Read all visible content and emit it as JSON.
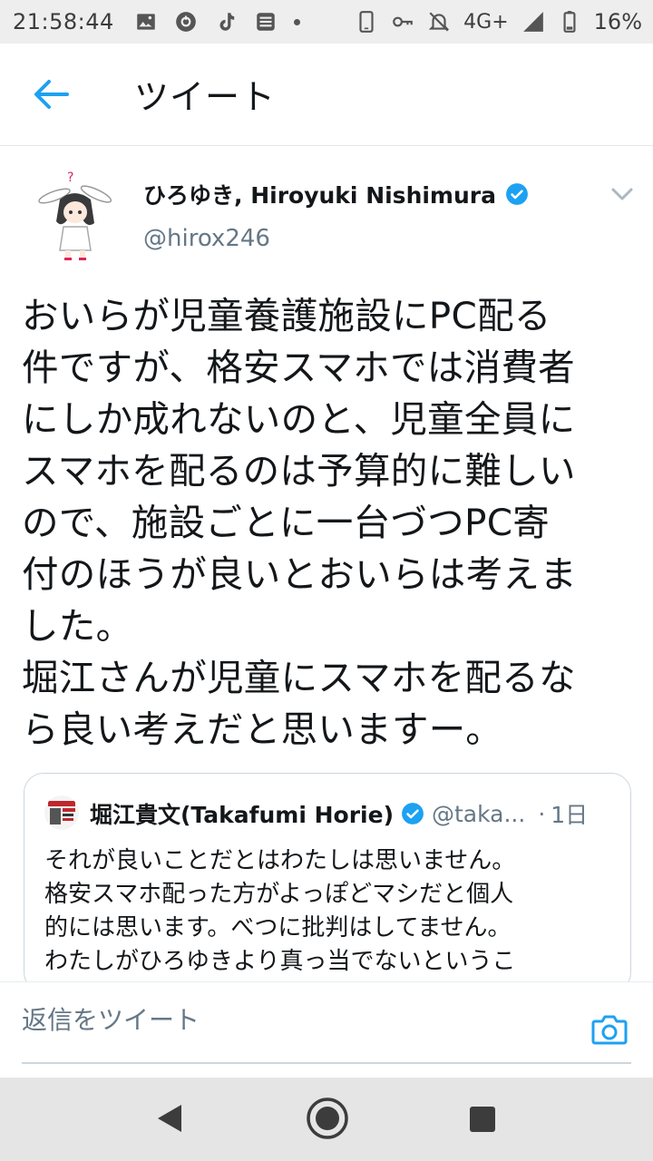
{
  "status_bar": {
    "time": "21:58:44",
    "network": "4G+",
    "battery": "16%",
    "icons": [
      "gallery-icon",
      "sync-icon",
      "tiktok-icon",
      "badge-icon",
      "notification-dot",
      "phone-icon",
      "key-icon",
      "mute-icon",
      "signal-icon",
      "battery-icon"
    ]
  },
  "header": {
    "title": "ツイート",
    "back_icon": "back-arrow-icon"
  },
  "tweet": {
    "author_name": "ひろゆき, Hiroyuki Nishimura",
    "author_handle": "@hirox246",
    "verified": true,
    "text": "おいらが児童養護施設にPC配る\n件ですが、格安スマホでは消費者\nにしか成れないのと、児童全員に\nスマホを配るのは予算的に難しい\nので、施設ごとに一台づつPC寄\n付のほうが良いとおいらは考えま\nした。\n堀江さんが児童にスマホを配るな\nら良い考えだと思いますー。"
  },
  "quote": {
    "author_name": "堀江貴文(Takafumi Horie)",
    "author_handle": "@taka...",
    "separator": "·",
    "time": "1日",
    "text": "それが良いことだとはわたしは思いません。\n格安スマホ配った方がよっぽどマシだと個人\n的には思います。べつに批判はしてません。\nわたしがひろゆきより真っ当でないというこ"
  },
  "reply": {
    "placeholder": "返信をツイート"
  },
  "colors": {
    "accent": "#1da1f2",
    "text": "#14171a",
    "secondary_text": "#657786",
    "border": "#ccd6dd"
  }
}
